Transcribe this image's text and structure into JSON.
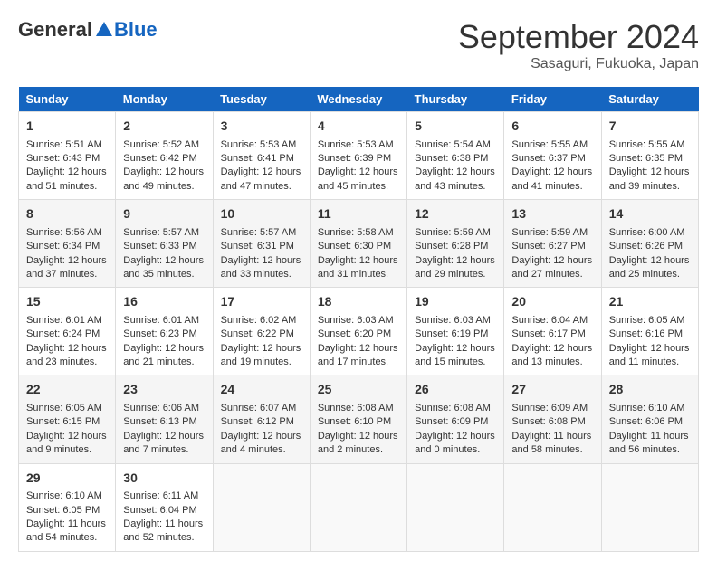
{
  "header": {
    "logo_general": "General",
    "logo_blue": "Blue",
    "month_title": "September 2024",
    "location": "Sasaguri, Fukuoka, Japan"
  },
  "weekdays": [
    "Sunday",
    "Monday",
    "Tuesday",
    "Wednesday",
    "Thursday",
    "Friday",
    "Saturday"
  ],
  "weeks": [
    [
      {
        "day": "1",
        "lines": [
          "Sunrise: 5:51 AM",
          "Sunset: 6:43 PM",
          "Daylight: 12 hours",
          "and 51 minutes."
        ]
      },
      {
        "day": "2",
        "lines": [
          "Sunrise: 5:52 AM",
          "Sunset: 6:42 PM",
          "Daylight: 12 hours",
          "and 49 minutes."
        ]
      },
      {
        "day": "3",
        "lines": [
          "Sunrise: 5:53 AM",
          "Sunset: 6:41 PM",
          "Daylight: 12 hours",
          "and 47 minutes."
        ]
      },
      {
        "day": "4",
        "lines": [
          "Sunrise: 5:53 AM",
          "Sunset: 6:39 PM",
          "Daylight: 12 hours",
          "and 45 minutes."
        ]
      },
      {
        "day": "5",
        "lines": [
          "Sunrise: 5:54 AM",
          "Sunset: 6:38 PM",
          "Daylight: 12 hours",
          "and 43 minutes."
        ]
      },
      {
        "day": "6",
        "lines": [
          "Sunrise: 5:55 AM",
          "Sunset: 6:37 PM",
          "Daylight: 12 hours",
          "and 41 minutes."
        ]
      },
      {
        "day": "7",
        "lines": [
          "Sunrise: 5:55 AM",
          "Sunset: 6:35 PM",
          "Daylight: 12 hours",
          "and 39 minutes."
        ]
      }
    ],
    [
      {
        "day": "8",
        "lines": [
          "Sunrise: 5:56 AM",
          "Sunset: 6:34 PM",
          "Daylight: 12 hours",
          "and 37 minutes."
        ]
      },
      {
        "day": "9",
        "lines": [
          "Sunrise: 5:57 AM",
          "Sunset: 6:33 PM",
          "Daylight: 12 hours",
          "and 35 minutes."
        ]
      },
      {
        "day": "10",
        "lines": [
          "Sunrise: 5:57 AM",
          "Sunset: 6:31 PM",
          "Daylight: 12 hours",
          "and 33 minutes."
        ]
      },
      {
        "day": "11",
        "lines": [
          "Sunrise: 5:58 AM",
          "Sunset: 6:30 PM",
          "Daylight: 12 hours",
          "and 31 minutes."
        ]
      },
      {
        "day": "12",
        "lines": [
          "Sunrise: 5:59 AM",
          "Sunset: 6:28 PM",
          "Daylight: 12 hours",
          "and 29 minutes."
        ]
      },
      {
        "day": "13",
        "lines": [
          "Sunrise: 5:59 AM",
          "Sunset: 6:27 PM",
          "Daylight: 12 hours",
          "and 27 minutes."
        ]
      },
      {
        "day": "14",
        "lines": [
          "Sunrise: 6:00 AM",
          "Sunset: 6:26 PM",
          "Daylight: 12 hours",
          "and 25 minutes."
        ]
      }
    ],
    [
      {
        "day": "15",
        "lines": [
          "Sunrise: 6:01 AM",
          "Sunset: 6:24 PM",
          "Daylight: 12 hours",
          "and 23 minutes."
        ]
      },
      {
        "day": "16",
        "lines": [
          "Sunrise: 6:01 AM",
          "Sunset: 6:23 PM",
          "Daylight: 12 hours",
          "and 21 minutes."
        ]
      },
      {
        "day": "17",
        "lines": [
          "Sunrise: 6:02 AM",
          "Sunset: 6:22 PM",
          "Daylight: 12 hours",
          "and 19 minutes."
        ]
      },
      {
        "day": "18",
        "lines": [
          "Sunrise: 6:03 AM",
          "Sunset: 6:20 PM",
          "Daylight: 12 hours",
          "and 17 minutes."
        ]
      },
      {
        "day": "19",
        "lines": [
          "Sunrise: 6:03 AM",
          "Sunset: 6:19 PM",
          "Daylight: 12 hours",
          "and 15 minutes."
        ]
      },
      {
        "day": "20",
        "lines": [
          "Sunrise: 6:04 AM",
          "Sunset: 6:17 PM",
          "Daylight: 12 hours",
          "and 13 minutes."
        ]
      },
      {
        "day": "21",
        "lines": [
          "Sunrise: 6:05 AM",
          "Sunset: 6:16 PM",
          "Daylight: 12 hours",
          "and 11 minutes."
        ]
      }
    ],
    [
      {
        "day": "22",
        "lines": [
          "Sunrise: 6:05 AM",
          "Sunset: 6:15 PM",
          "Daylight: 12 hours",
          "and 9 minutes."
        ]
      },
      {
        "day": "23",
        "lines": [
          "Sunrise: 6:06 AM",
          "Sunset: 6:13 PM",
          "Daylight: 12 hours",
          "and 7 minutes."
        ]
      },
      {
        "day": "24",
        "lines": [
          "Sunrise: 6:07 AM",
          "Sunset: 6:12 PM",
          "Daylight: 12 hours",
          "and 4 minutes."
        ]
      },
      {
        "day": "25",
        "lines": [
          "Sunrise: 6:08 AM",
          "Sunset: 6:10 PM",
          "Daylight: 12 hours",
          "and 2 minutes."
        ]
      },
      {
        "day": "26",
        "lines": [
          "Sunrise: 6:08 AM",
          "Sunset: 6:09 PM",
          "Daylight: 12 hours",
          "and 0 minutes."
        ]
      },
      {
        "day": "27",
        "lines": [
          "Sunrise: 6:09 AM",
          "Sunset: 6:08 PM",
          "Daylight: 11 hours",
          "and 58 minutes."
        ]
      },
      {
        "day": "28",
        "lines": [
          "Sunrise: 6:10 AM",
          "Sunset: 6:06 PM",
          "Daylight: 11 hours",
          "and 56 minutes."
        ]
      }
    ],
    [
      {
        "day": "29",
        "lines": [
          "Sunrise: 6:10 AM",
          "Sunset: 6:05 PM",
          "Daylight: 11 hours",
          "and 54 minutes."
        ]
      },
      {
        "day": "30",
        "lines": [
          "Sunrise: 6:11 AM",
          "Sunset: 6:04 PM",
          "Daylight: 11 hours",
          "and 52 minutes."
        ]
      },
      {
        "day": "",
        "lines": []
      },
      {
        "day": "",
        "lines": []
      },
      {
        "day": "",
        "lines": []
      },
      {
        "day": "",
        "lines": []
      },
      {
        "day": "",
        "lines": []
      }
    ]
  ]
}
